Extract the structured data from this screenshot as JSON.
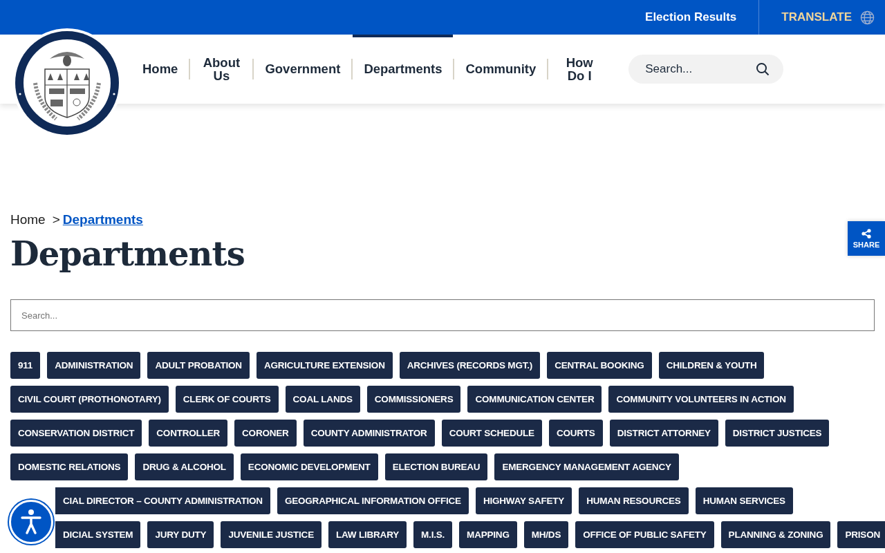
{
  "top_bar": {
    "links": [
      {
        "label": "Election Results",
        "kind": "link"
      },
      {
        "label": "TRANSLATE",
        "kind": "translate"
      }
    ]
  },
  "nav": {
    "items": [
      {
        "label": "Home",
        "selected": false
      },
      {
        "label": "About Us",
        "selected": false
      },
      {
        "label": "Government",
        "selected": false
      },
      {
        "label": "Departments",
        "selected": true
      },
      {
        "label": "Community",
        "selected": false
      },
      {
        "label": "How Do I",
        "selected": false
      }
    ],
    "search": {
      "placeholder": "Search..."
    }
  },
  "breadcrumb": [
    {
      "label": "Home",
      "current": false
    },
    {
      "label": "Departments",
      "current": true
    }
  ],
  "breadcrumb_separator": ">",
  "title": "Departments",
  "filter": {
    "placeholder": "Search..."
  },
  "departments": [
    "911",
    "ADMINISTRATION",
    "ADULT PROBATION",
    "AGRICULTURE EXTENSION",
    "ARCHIVES (RECORDS MGT.)",
    "CENTRAL BOOKING",
    "CHILDREN & YOUTH",
    "CIVIL COURT (PROTHONOTARY)",
    "CLERK OF COURTS",
    "COAL LANDS",
    "COMMISSIONERS",
    "COMMUNICATION CENTER",
    "COMMUNITY VOLUNTEERS IN ACTION",
    "CONSERVATION DISTRICT",
    "CONTROLLER",
    "CORONER",
    "COUNTY ADMINISTRATOR",
    "COURT SCHEDULE",
    "COURTS",
    "DISTRICT ATTORNEY",
    "DISTRICT JUSTICES",
    "DOMESTIC RELATIONS",
    "DRUG & ALCOHOL",
    "ECONOMIC DEVELOPMENT",
    "ELECTION BUREAU",
    "EMERGENCY MANAGEMENT AGENCY",
    "CIAL DIRECTOR – COUNTY ADMINISTRATION",
    "GEOGRAPHICAL INFORMATION OFFICE",
    "HIGHWAY SAFETY",
    "HUMAN RESOURCES",
    "HUMAN SERVICES",
    "DICIAL SYSTEM",
    "JURY DUTY",
    "JUVENILE JUSTICE",
    "LAW LIBRARY",
    "M.I.S.",
    "MAPPING",
    "MH/DS",
    "OFFICE OF PUBLIC SAFETY",
    "PLANNING & ZONING",
    "PRISON"
  ],
  "share": {
    "label": "SHARE"
  }
}
